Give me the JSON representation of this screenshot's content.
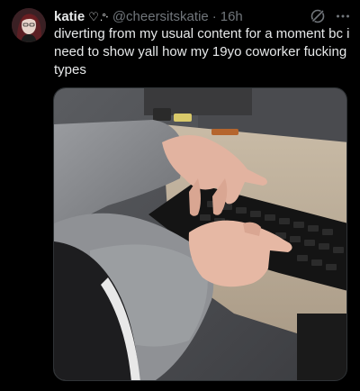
{
  "post": {
    "author": {
      "name": "katie",
      "handle": "@cheersitskatie",
      "heart_glyph": "♡",
      "deco_glyph": ".°‧"
    },
    "separator": "·",
    "timestamp": "16h",
    "text": "diverting from my usual content for a moment bc i need to show yall how my 19yo coworker fucking types",
    "icons": [
      "grok-icon",
      "more-icon",
      "avatar-photo",
      "media-photo"
    ],
    "colors": {
      "background": "#000000",
      "primary_text": "#e7e9ea",
      "secondary_text": "#71767b"
    }
  }
}
